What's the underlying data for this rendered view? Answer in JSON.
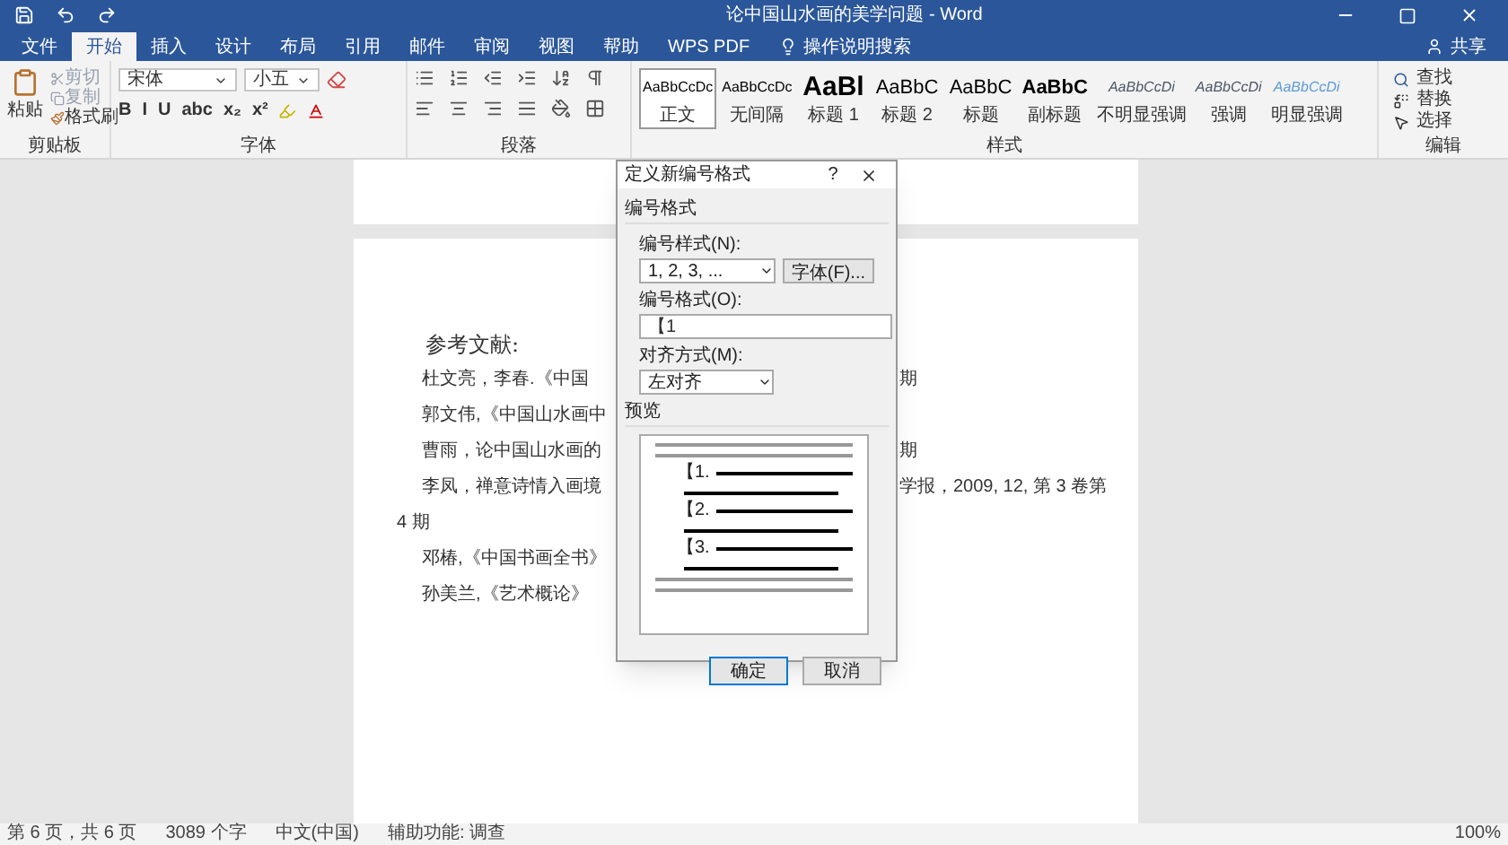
{
  "window": {
    "title": "论中国山水画的美学问题 - Word"
  },
  "tabs": [
    {
      "label": "文件",
      "selected": false
    },
    {
      "label": "开始",
      "selected": true
    },
    {
      "label": "插入",
      "selected": false
    },
    {
      "label": "设计",
      "selected": false
    },
    {
      "label": "布局",
      "selected": false
    },
    {
      "label": "引用",
      "selected": false
    },
    {
      "label": "邮件",
      "selected": false
    },
    {
      "label": "审阅",
      "selected": false
    },
    {
      "label": "视图",
      "selected": false
    },
    {
      "label": "帮助",
      "selected": false
    },
    {
      "label": "WPS PDF",
      "selected": false
    }
  ],
  "tell_me": "操作说明搜索",
  "share": "共享",
  "clipboard": {
    "paste": "粘贴",
    "cut": "剪切",
    "copy": "复制",
    "format_painter": "格式刷",
    "label": "剪贴板"
  },
  "font": {
    "name": "宋体",
    "size": "小五",
    "format_buttons": [
      "B",
      "I",
      "U",
      "abc",
      "x₂",
      "x²"
    ],
    "label": "字体"
  },
  "paragraph": {
    "label": "段落"
  },
  "styles": {
    "items": [
      {
        "preview": "AaBbCcDc",
        "name": "正文",
        "kind": "normal",
        "selected": true
      },
      {
        "preview": "AaBbCcDc",
        "name": "无间隔",
        "kind": "normal",
        "selected": false
      },
      {
        "preview": "AaBl",
        "name": "标题 1",
        "kind": "heading1",
        "selected": false
      },
      {
        "preview": "AaBbC",
        "name": "标题 2",
        "kind": "heading2",
        "selected": false
      },
      {
        "preview": "AaBbC",
        "name": "标题",
        "kind": "heading2",
        "selected": false
      },
      {
        "preview": "AaBbC",
        "name": "副标题",
        "kind": "subtitle",
        "selected": false
      },
      {
        "preview": "AaBbCcDi",
        "name": "不明显强调",
        "kind": "emphasis",
        "selected": false
      },
      {
        "preview": "AaBbCcDi",
        "name": "强调",
        "kind": "emphasis",
        "selected": false
      },
      {
        "preview": "AaBbCcDi",
        "name": "明显强调",
        "kind": "intense",
        "selected": false
      }
    ],
    "label": "样式"
  },
  "editing": {
    "find": "查找",
    "replace": "替换",
    "select": "选择",
    "label": "编辑"
  },
  "document": {
    "heading": "参考文献:",
    "lines": [
      {
        "left": "杜文亮，李春.《中国",
        "right": "期"
      },
      {
        "left": "郭文伟,《中国山水画中"
      },
      {
        "left": "曹雨，论中国山水画的",
        "right": "期"
      },
      {
        "left": "李凤，禅意诗情入画境",
        "right": "学报，2009, 12, 第 3 卷第"
      },
      {
        "left": "4 期",
        "hanging": true
      },
      {
        "left": "邓椿,《中国书画全书》"
      },
      {
        "left": "孙美兰,《艺术概论》"
      }
    ]
  },
  "dialog": {
    "title": "定义新编号格式",
    "help": "?",
    "section": "编号格式",
    "style_label": "编号样式(N):",
    "style_value": "1, 2, 3, ...",
    "font_button": "字体(F)...",
    "format_label": "编号格式(O):",
    "format_value": "【1",
    "align_label": "对齐方式(M):",
    "align_value": "左对齐",
    "preview_label": "预览",
    "preview_numbers": [
      "【1.",
      "【2.",
      "【3."
    ],
    "ok": "确定",
    "cancel": "取消"
  },
  "status_bar": {
    "page": "第 6 页，共 6 页",
    "words": "3089 个字",
    "language": "中文(中国)",
    "accessibility": "辅助功能: 调查",
    "zoom": "100%"
  }
}
